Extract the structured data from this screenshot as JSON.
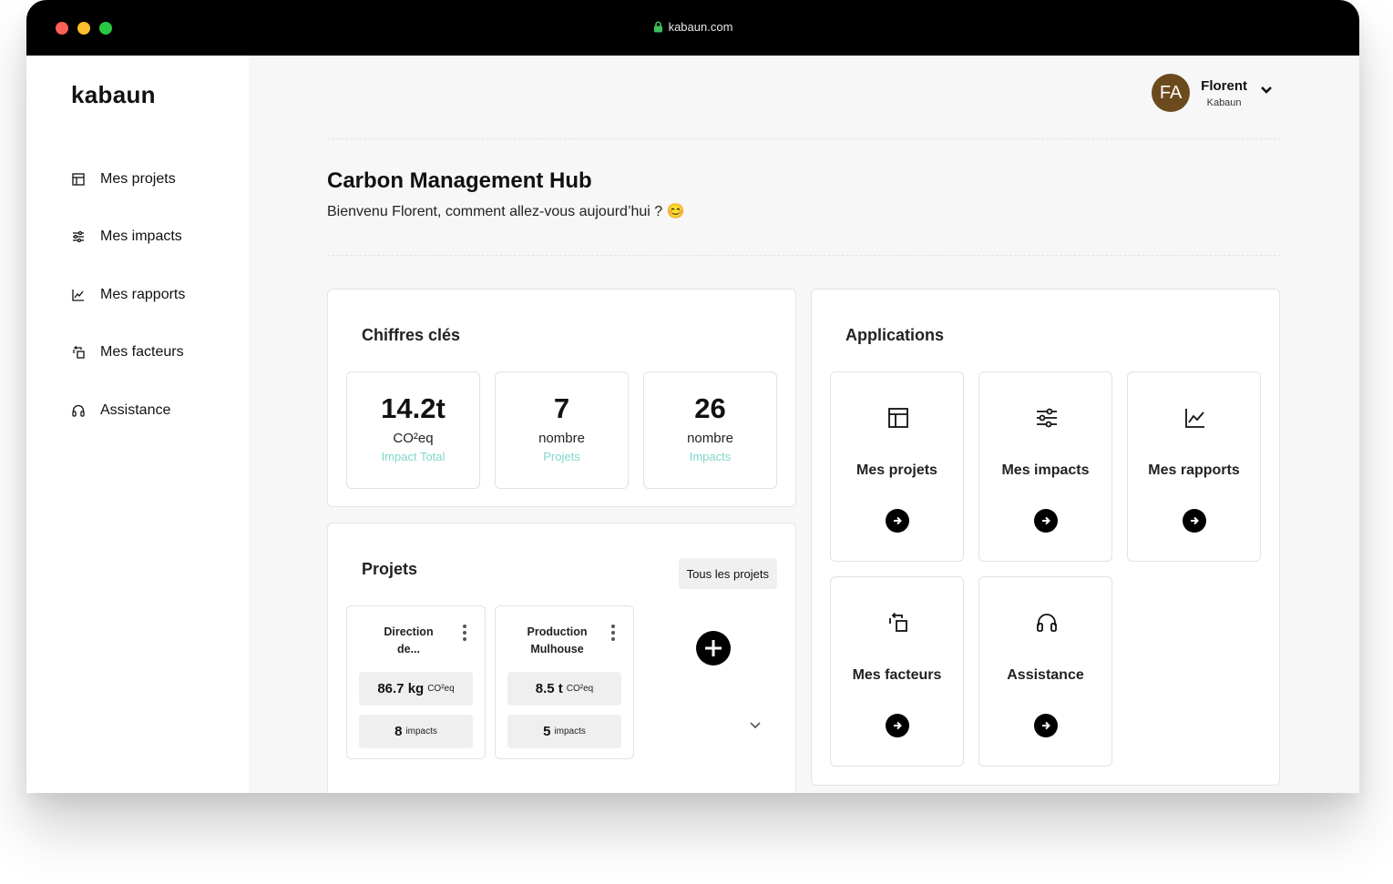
{
  "browser": {
    "url": "kabaun.com"
  },
  "sidebar": {
    "logo": "kabaun",
    "items": [
      {
        "label": "Mes projets",
        "icon": "layout-icon"
      },
      {
        "label": "Mes impacts",
        "icon": "sliders-icon"
      },
      {
        "label": "Mes rapports",
        "icon": "chart-line-icon"
      },
      {
        "label": "Mes facteurs",
        "icon": "copy-arrow-icon"
      },
      {
        "label": "Assistance",
        "icon": "headset-icon"
      }
    ]
  },
  "user": {
    "initials": "FA",
    "name": "Florent",
    "org": "Kabaun",
    "avatar_color": "#6b4a1d"
  },
  "header": {
    "title": "Carbon Management Hub",
    "subtitle": "Bienvenu Florent, comment allez-vous aujourd’hui ? 😊"
  },
  "key_figures": {
    "title": "Chiffres clés",
    "stats": [
      {
        "value": "14.2t",
        "unit": "CO²eq",
        "label": "Impact Total"
      },
      {
        "value": "7",
        "unit": "nombre",
        "label": "Projets"
      },
      {
        "value": "26",
        "unit": "nombre",
        "label": "Impacts"
      }
    ],
    "label_color": "#7fd6c9"
  },
  "projects": {
    "title": "Projets",
    "all_button": "Tous les projets",
    "items": [
      {
        "name_line1": "Direction",
        "name_line2": "de...",
        "co2_value": "86.7 kg",
        "co2_unit": "CO²eq",
        "impacts_count": "8",
        "impacts_label": "impacts"
      },
      {
        "name_line1": "Production",
        "name_line2": "Mulhouse",
        "co2_value": "8.5 t",
        "co2_unit": "CO²eq",
        "impacts_count": "5",
        "impacts_label": "impacts"
      }
    ]
  },
  "applications": {
    "title": "Applications",
    "items": [
      {
        "label": "Mes projets",
        "icon": "layout-icon"
      },
      {
        "label": "Mes impacts",
        "icon": "sliders-icon"
      },
      {
        "label": "Mes rapports",
        "icon": "chart-line-icon"
      },
      {
        "label": "Mes facteurs",
        "icon": "copy-arrow-icon"
      },
      {
        "label": "Assistance",
        "icon": "headset-icon"
      }
    ]
  }
}
